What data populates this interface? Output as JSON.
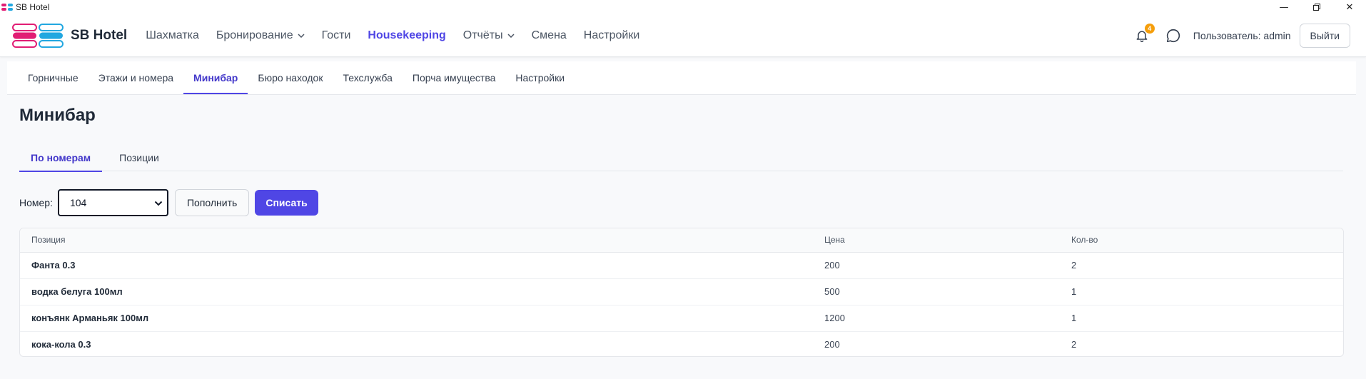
{
  "window": {
    "title": "SB Hotel",
    "controls": [
      "minimize-icon",
      "restore-icon",
      "close-icon"
    ]
  },
  "header": {
    "brand": "SB Hotel",
    "nav": [
      {
        "label": "Шахматка",
        "dropdown": false,
        "active": false
      },
      {
        "label": "Бронирование",
        "dropdown": true,
        "active": false
      },
      {
        "label": "Гости",
        "dropdown": false,
        "active": false
      },
      {
        "label": "Housekeeping",
        "dropdown": false,
        "active": true
      },
      {
        "label": "Отчёты",
        "dropdown": true,
        "active": false
      },
      {
        "label": "Смена",
        "dropdown": false,
        "active": false
      },
      {
        "label": "Настройки",
        "dropdown": false,
        "active": false
      }
    ],
    "notifications_count": "4",
    "user_label": "Пользователь: admin",
    "logout_label": "Выйти"
  },
  "subnav": {
    "items": [
      "Горничные",
      "Этажи и номера",
      "Минибар",
      "Бюро находок",
      "Техслужба",
      "Порча имущества",
      "Настройки"
    ],
    "active": "Минибар"
  },
  "page": {
    "title": "Минибар",
    "tabs": [
      "По номерам",
      "Позиции"
    ],
    "active_tab": "По номерам"
  },
  "controls": {
    "room_label": "Номер:",
    "room_value": "104",
    "refill_label": "Пополнить",
    "writeoff_label": "Списать"
  },
  "table": {
    "columns": [
      "Позиция",
      "Цена",
      "Кол-во"
    ],
    "rows": [
      {
        "name": "Фанта 0.3",
        "price": "200",
        "qty": "2"
      },
      {
        "name": "водка белуга 100мл",
        "price": "500",
        "qty": "1"
      },
      {
        "name": "конъянк Арманьяк 100мл",
        "price": "1200",
        "qty": "1"
      },
      {
        "name": "кока-кола 0.3",
        "price": "200",
        "qty": "2"
      }
    ]
  },
  "colors": {
    "accent": "#4f46e5",
    "badge": "#f59e0b",
    "logo_pink": "#e11d74",
    "logo_blue": "#22a7e0"
  }
}
